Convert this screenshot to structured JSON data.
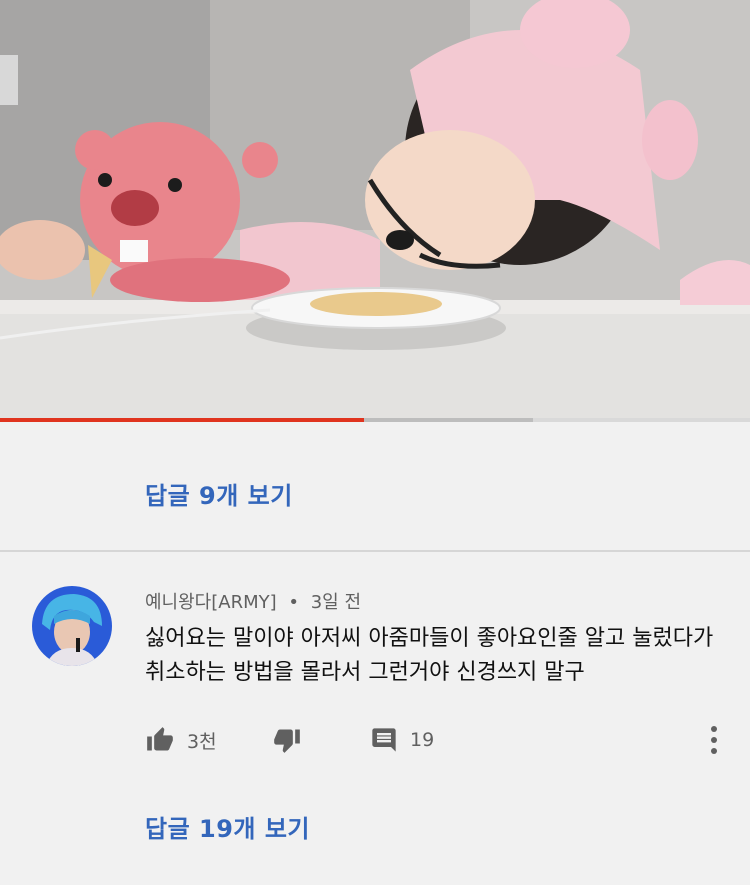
{
  "colors": {
    "accent": "#3366bb",
    "progress_played": "#e0341f",
    "icon": "#606060"
  },
  "video": {
    "progress_fraction": 0.485,
    "buffered_fraction": 0.71
  },
  "thread1": {
    "view_replies_label": "답글 9개 보기"
  },
  "comment": {
    "author": "예니왕다[ARMY]",
    "separator": "•",
    "time": "3일 전",
    "text": "싫어요는 말이야 아저씨 아줌마들이 좋아요인줄 알고 눌렀다가 취소하는 방법을 몰라서 그런거야 신경쓰지 말구",
    "likes": "3천",
    "replies_count": "19",
    "like_icon": "thumbs-up-icon",
    "dislike_icon": "thumbs-down-icon",
    "reply_icon": "comment-icon",
    "menu_icon": "more-vertical-icon",
    "view_replies_label": "답글 19개 보기"
  }
}
